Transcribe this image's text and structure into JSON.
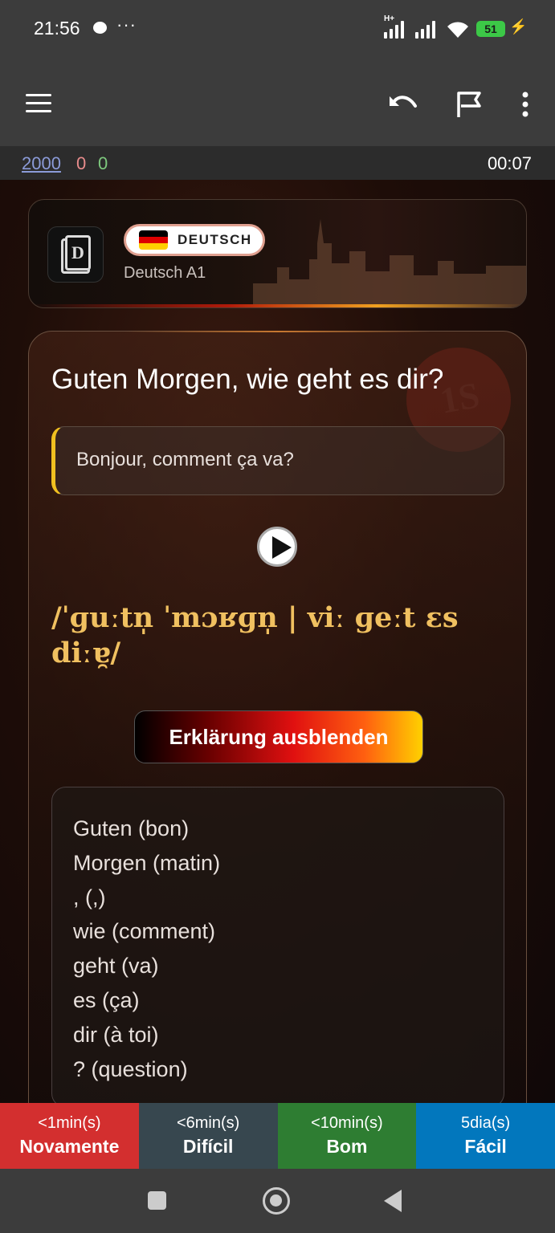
{
  "status": {
    "time": "21:56",
    "dots": "···",
    "network": "H+",
    "battery": "51"
  },
  "counts": {
    "new": "2000",
    "learning": "0",
    "review": "0",
    "timer": "00:07"
  },
  "deck": {
    "language": "DEUTSCH",
    "name": "Deutsch A1"
  },
  "card": {
    "question": "Guten Morgen, wie geht es dir?",
    "answer": "Bonjour, comment ça va?",
    "badge": "1S",
    "ipa": "/ˈɡuːtn̩ ˈmɔʁɡn̩ | viː ɡeːt ɛs diːɐ̯/",
    "toggle_label": "Erklärung ausblenden",
    "explanation": [
      "Guten (bon)",
      "Morgen (matin)",
      ", (,)",
      "wie (comment)",
      "geht (va)",
      "es (ça)",
      "dir (à toi)",
      "? (question)"
    ]
  },
  "buttons": [
    {
      "time": "<1min(s)",
      "label": "Novamente",
      "color": "#d32f2f"
    },
    {
      "time": "<6min(s)",
      "label": "Difícil",
      "color": "#37474f"
    },
    {
      "time": "<10min(s)",
      "label": "Bom",
      "color": "#2e7d32"
    },
    {
      "time": "5dia(s)",
      "label": "Fácil",
      "color": "#0277bd"
    }
  ],
  "colors": {
    "bar": "#3c3c3c",
    "accent_ipa": "#f0c060",
    "answer_border": "#f0c020"
  }
}
